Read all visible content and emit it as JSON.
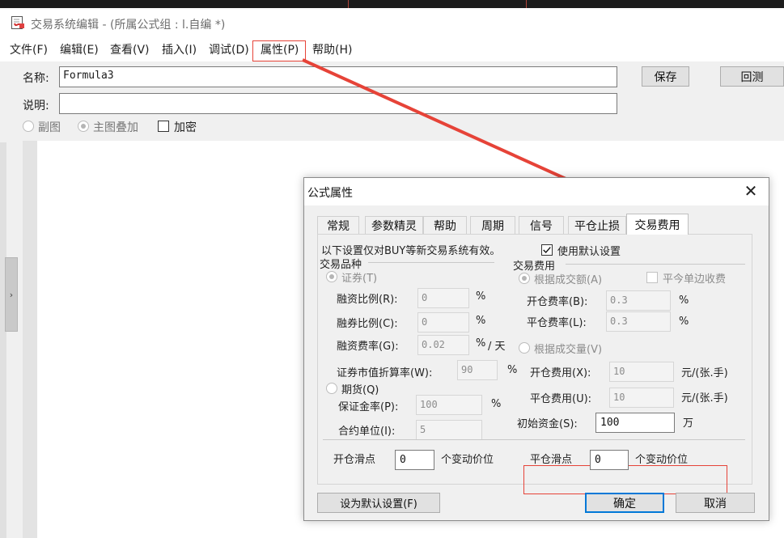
{
  "window": {
    "title": "交易系统编辑 - (所属公式组 : l.自编 *)"
  },
  "menu": [
    "文件(F)",
    "编辑(E)",
    "查看(V)",
    "插入(I)",
    "调试(D)",
    "属性(P)",
    "帮助(H)"
  ],
  "form": {
    "name_label": "名称:",
    "name_value": "Formula3",
    "desc_label": "说明:",
    "desc_value": "",
    "save_label": "保存",
    "backtest_label": "回测",
    "radio_sub": "副图",
    "radio_main": "主图叠加",
    "encrypt_label": "加密"
  },
  "dialog": {
    "title": "公式属性",
    "tabs": [
      "常规",
      "参数精灵",
      "帮助",
      "周期",
      "信号",
      "平仓止损",
      "交易费用"
    ],
    "active_tab": "交易费用",
    "notice": "以下设置仅对BUY等新交易系统有效。",
    "use_default_label": "使用默认设置",
    "use_default_checked": true,
    "variety": {
      "header": "交易品种",
      "securities_label": "证券(T)",
      "margin_ratio_label": "融资比例(R):",
      "margin_ratio_value": "0",
      "short_ratio_label": "融券比例(C):",
      "short_ratio_value": "0",
      "margin_fee_label": "融资费率(G):",
      "margin_fee_value": "0.02",
      "pct": "%",
      "per_day": "/ 天",
      "discount_label": "证券市值折算率(W):",
      "discount_value": "90",
      "futures_label": "期货(Q)",
      "deposit_label": "保证金率(P):",
      "deposit_value": "100",
      "contract_label": "合约单位(I):",
      "contract_value": "5"
    },
    "fee": {
      "header": "交易费用",
      "by_amount_label": "根据成交额(A)",
      "close_today_label": "平今单边收费",
      "open_rate_label": "开仓费率(B):",
      "open_rate_value": "0.3",
      "close_rate_label": "平仓费率(L):",
      "close_rate_value": "0.3",
      "by_volume_label": "根据成交量(V)",
      "open_cost_label": "开仓费用(X):",
      "open_cost_value": "10",
      "close_cost_label": "平仓费用(U):",
      "close_cost_value": "10",
      "unit_per_lot": "元/(张.手)",
      "initial_fund_label": "初始资金(S):",
      "initial_fund_value": "100",
      "initial_fund_unit": "万"
    },
    "slippage": {
      "open_label": "开仓滑点",
      "open_value": "0",
      "close_label": "平仓滑点",
      "close_value": "0",
      "unit": "个变动价位"
    },
    "set_default_label": "设为默认设置(F)",
    "ok_label": "确定",
    "cancel_label": "取消"
  },
  "colors": {
    "highlight": "#e64338",
    "window_bg": "#f0f0f0"
  }
}
